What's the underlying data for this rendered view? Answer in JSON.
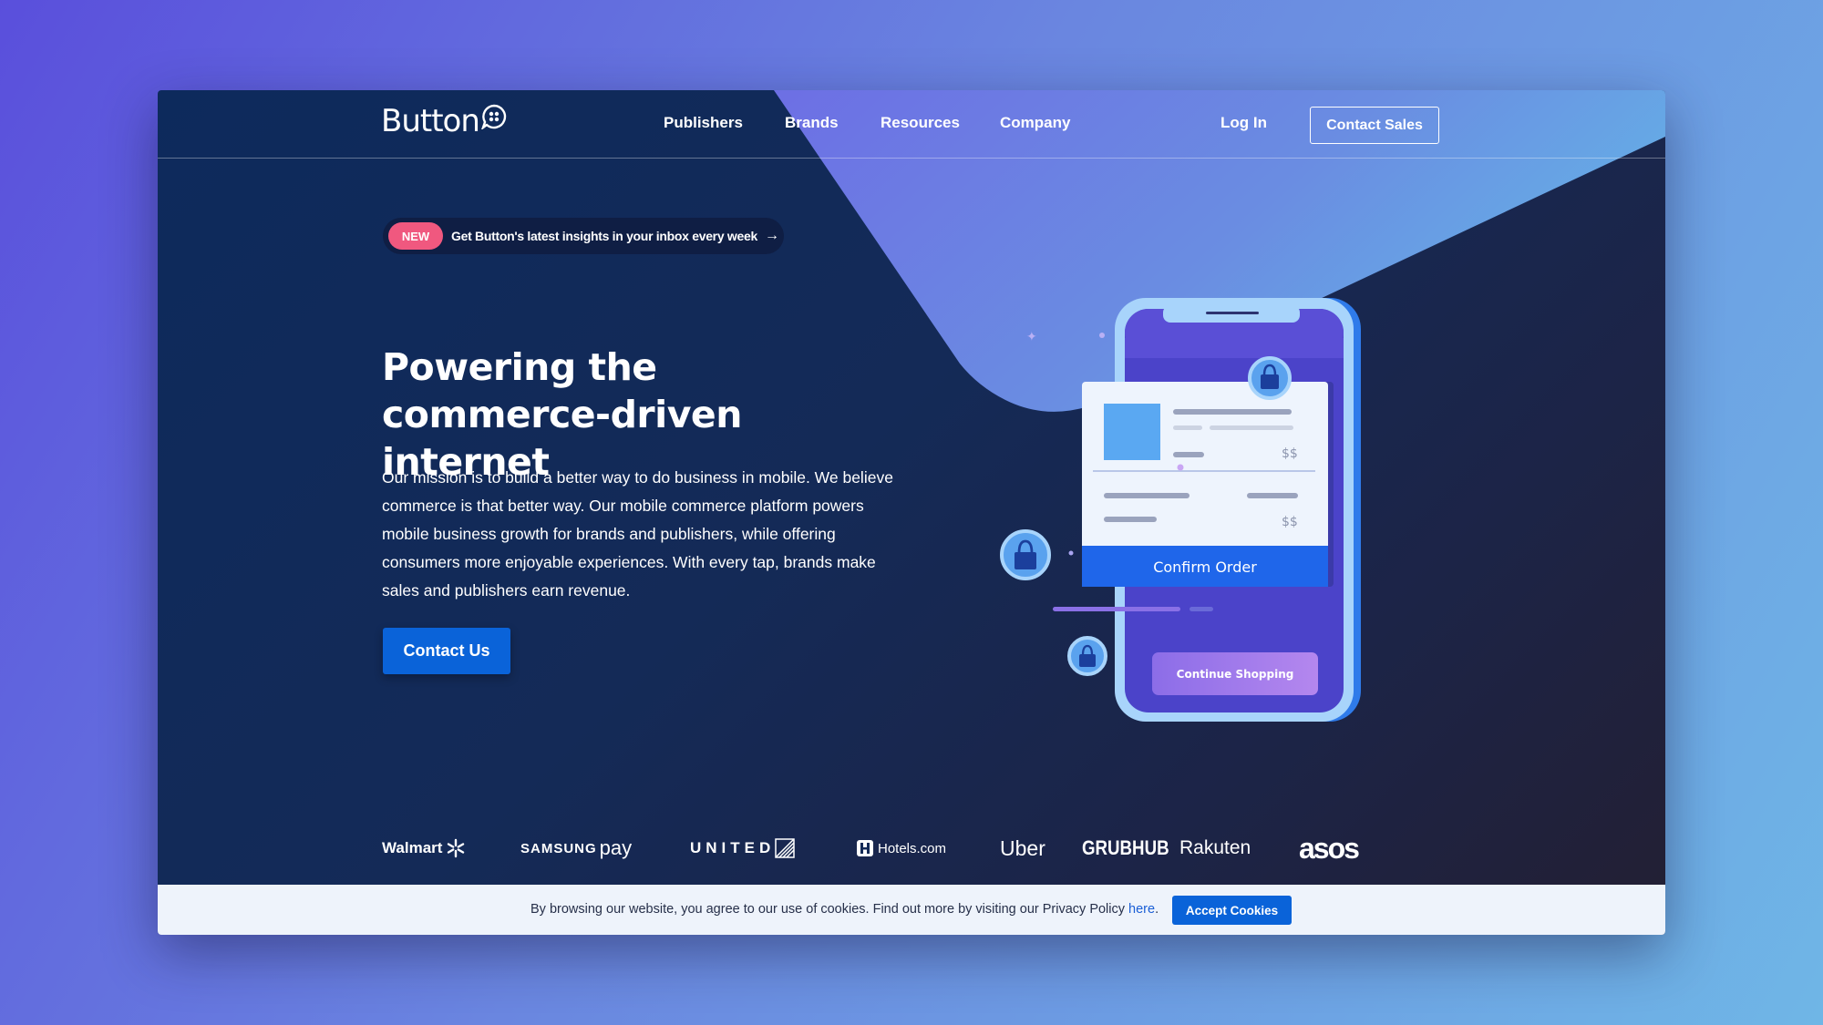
{
  "nav": {
    "logo": "Button",
    "links": [
      "Publishers",
      "Brands",
      "Resources",
      "Company"
    ],
    "login": "Log In",
    "contact_sales": "Contact Sales"
  },
  "banner": {
    "badge": "NEW",
    "text": "Get Button's latest insights in your inbox every week",
    "arrow": "→"
  },
  "hero": {
    "title": "Powering the commerce-driven internet",
    "body": "Our mission is to build a better way to do business in mobile. We believe commerce is that better way. Our mobile commerce platform powers mobile business growth for brands and publishers, while offering consumers more enjoyable experiences. With every tap, brands make sales and publishers earn revenue.",
    "cta": "Contact Us"
  },
  "phone": {
    "price1": "$$",
    "price2": "$$",
    "confirm": "Confirm Order",
    "continue": "Continue Shopping"
  },
  "brands": [
    "Walmart",
    "SAMSUNG",
    "pay",
    "UNITED",
    "Hotels.com",
    "Uber",
    "GRUBHUB",
    "Rakuten",
    "asos"
  ],
  "cookie": {
    "text": "By browsing our website, you agree to our use of cookies. Find out more by visiting our Privacy Policy ",
    "link": "here",
    "end": ".",
    "accept": "Accept Cookies"
  },
  "colors": {
    "accent": "#0a63d9",
    "badge": "#f0587f",
    "purple": "#6b7ee8",
    "phone_screen": "#5a4fd6"
  }
}
